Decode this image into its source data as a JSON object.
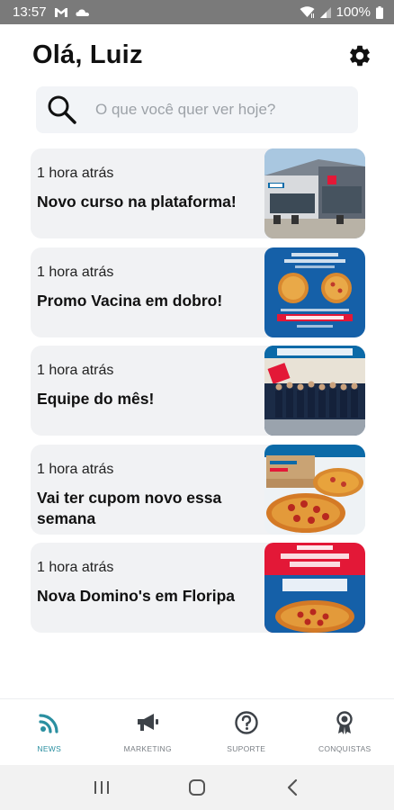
{
  "status_bar": {
    "time": "13:57",
    "battery": "100%",
    "icons": [
      "gmail-icon",
      "cloud-icon",
      "wifi-icon",
      "signal-icon",
      "battery-icon"
    ]
  },
  "header": {
    "greeting": "Olá, Luiz",
    "settings_icon": "gear-icon"
  },
  "search": {
    "placeholder": "O que você quer ver hoje?",
    "value": ""
  },
  "feed": [
    {
      "time": "1 hora atrás",
      "title": "Novo curso na plataforma!",
      "image": "store-photo"
    },
    {
      "time": "1 hora atrás",
      "title": "Promo Vacina em dobro!",
      "image": "promo-pizza-photo"
    },
    {
      "time": "1 hora atrás",
      "title": "Equipe do mês!",
      "image": "team-photo"
    },
    {
      "time": "1 hora atrás",
      "title": "Vai ter cupom novo essa semana",
      "image": "pizza-boxes-photo"
    },
    {
      "time": "1 hora atrás",
      "title": "Nova Domino's em Floripa",
      "image": "floripa-promo-photo"
    }
  ],
  "bottom_nav": [
    {
      "label": "NEWS",
      "icon": "rss-icon",
      "active": true
    },
    {
      "label": "MARKETING",
      "icon": "megaphone-icon",
      "active": false
    },
    {
      "label": "SUPORTE",
      "icon": "help-circle-icon",
      "active": false
    },
    {
      "label": "CONQUISTAS",
      "icon": "award-icon",
      "active": false
    }
  ],
  "colors": {
    "accent": "#2a8fa0",
    "card_bg": "#f1f2f4",
    "status_bar": "#7a7a7a",
    "dominos_blue": "#0b6aa8",
    "dominos_red": "#e31837"
  }
}
